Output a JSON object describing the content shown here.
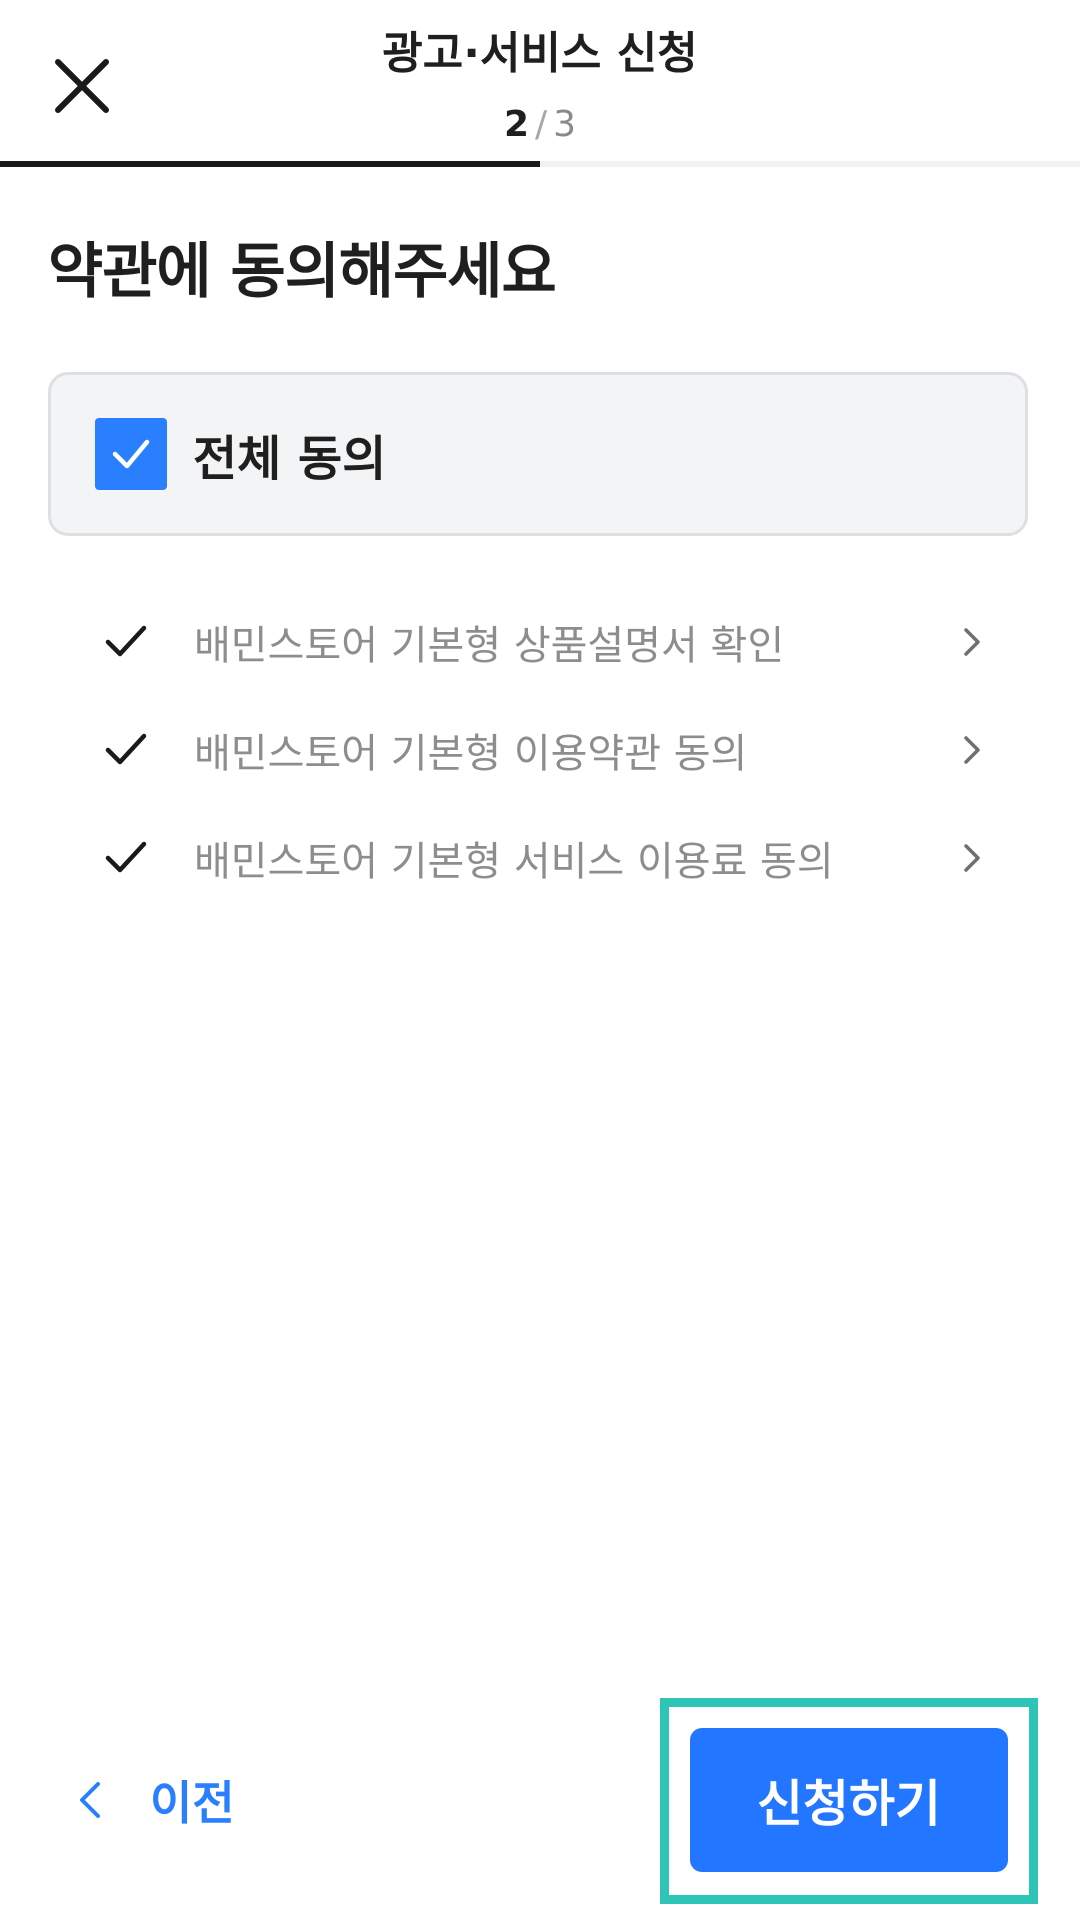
{
  "header": {
    "title": "광고·서비스 신청",
    "step_current": "2",
    "step_separator": "/",
    "step_total": "3",
    "progress_fraction": 0.5,
    "close_icon": "close-icon"
  },
  "content": {
    "title": "약관에 동의해주세요",
    "agree_all": {
      "label": "전체 동의",
      "checked": true
    },
    "terms": [
      {
        "label": "배민스토어 기본형 상품설명서 확인",
        "checked": true
      },
      {
        "label": "배민스토어 기본형 이용약관 동의",
        "checked": true
      },
      {
        "label": "배민스토어 기본형 서비스 이용료 동의",
        "checked": true
      }
    ]
  },
  "footer": {
    "prev_label": "이전",
    "submit_label": "신청하기"
  },
  "colors": {
    "accent": "#2276ff",
    "checkbox": "#2a7fff",
    "highlight": "#2ec4b6",
    "term_text": "#8d8d8d",
    "box_bg": "#f3f4f6"
  }
}
